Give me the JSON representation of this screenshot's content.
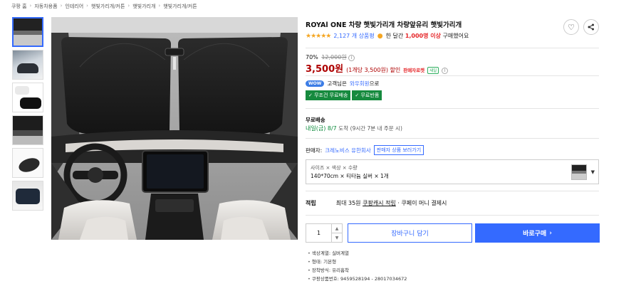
{
  "breadcrumb": [
    "쿠팡 홈",
    "자동차용품",
    "인테리어",
    "햇빛가리개/커튼",
    "햇빛가리개",
    "햇빛가리개/커튼"
  ],
  "product": {
    "title": "ROYAl ONE 차량 햇빛가리개 차량앞유리 햇빛가리개",
    "stars": "★★★★★",
    "review_count": "2,127 개 상품평",
    "buyers_prefix": "한 달간",
    "buyers_count": "1,000명 이상",
    "buyers_suffix": "구매했어요"
  },
  "price": {
    "discount_rate": "70%",
    "original": "12,000원",
    "current": "3,500원",
    "unit": "(1개당 3,500원) 할인",
    "direct_badge": "판매자로켓",
    "tiny_badge": "새일",
    "info_symbol": "i"
  },
  "membership": {
    "wow_badge": "WOW",
    "text_prefix": "고객님은",
    "member_link": "와우회원",
    "text_suffix": "으로",
    "badges": [
      "✓ 무조건 무료배송",
      "✓ 무료반품"
    ]
  },
  "shipping": {
    "label": "무료배송",
    "arrival": "내일(금) 8/7",
    "arrive_word": "도착",
    "note": "(9시간 7분 내 주문 시)"
  },
  "seller": {
    "label": "판매자:",
    "name": "크레노비스 유한회사",
    "more": "판매자 상품 보러가기"
  },
  "option": {
    "label": "사이즈 × 색상 × 수량",
    "value": "140*70cm × 티타늄 실버 × 1개"
  },
  "reward": {
    "label": "적립",
    "prefix": "최대 35원",
    "link": "쿠팡캐시 적립",
    "suffix": "· 쿠페이 머니 결제시"
  },
  "purchase": {
    "quantity": "1",
    "cart": "장바구니 담기",
    "buy": "바로구매",
    "buy_arrow": "›"
  },
  "specs": [
    "색상계열: 실버계열",
    "형태: 기본형",
    "장착방식: 유리흡착",
    "쿠팡상품번호: 9459528194 - 28017034672"
  ],
  "icons": {
    "heart": "♡",
    "share": "⟨"
  }
}
